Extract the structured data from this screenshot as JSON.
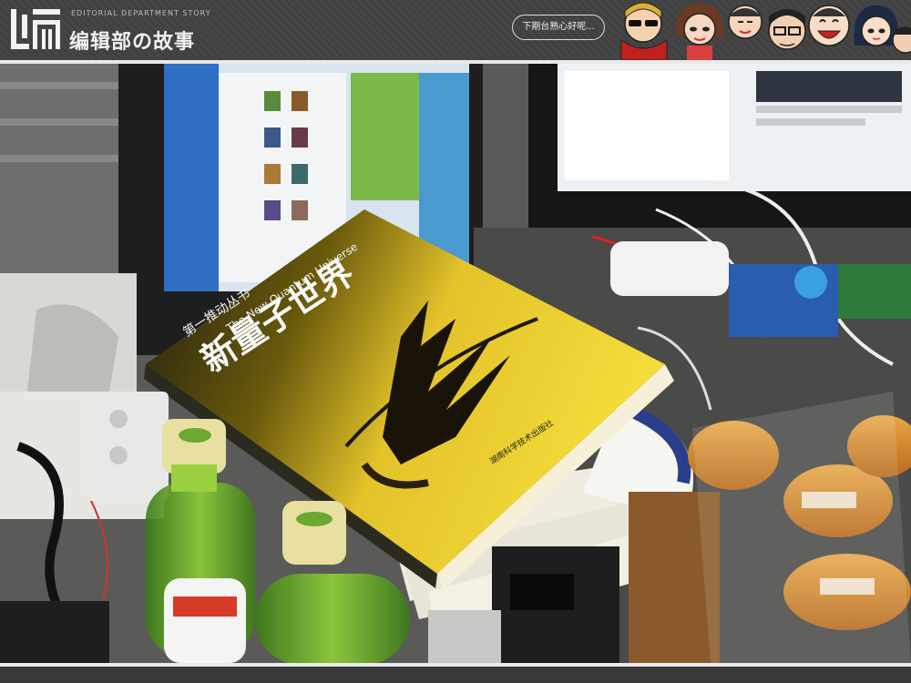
{
  "header": {
    "logo_glyph": "编",
    "subtitle": "EDITORIAL DEPARTMENT STORY",
    "title": "编辑部の故事",
    "speech_bubble": "下期台熟心好呢..."
  },
  "photo": {
    "book": {
      "series": "第一推动丛书",
      "title_cn": "新量子世界",
      "title_en": "The New Quantum Universe",
      "publisher": "湖南科学技术出版社"
    }
  }
}
